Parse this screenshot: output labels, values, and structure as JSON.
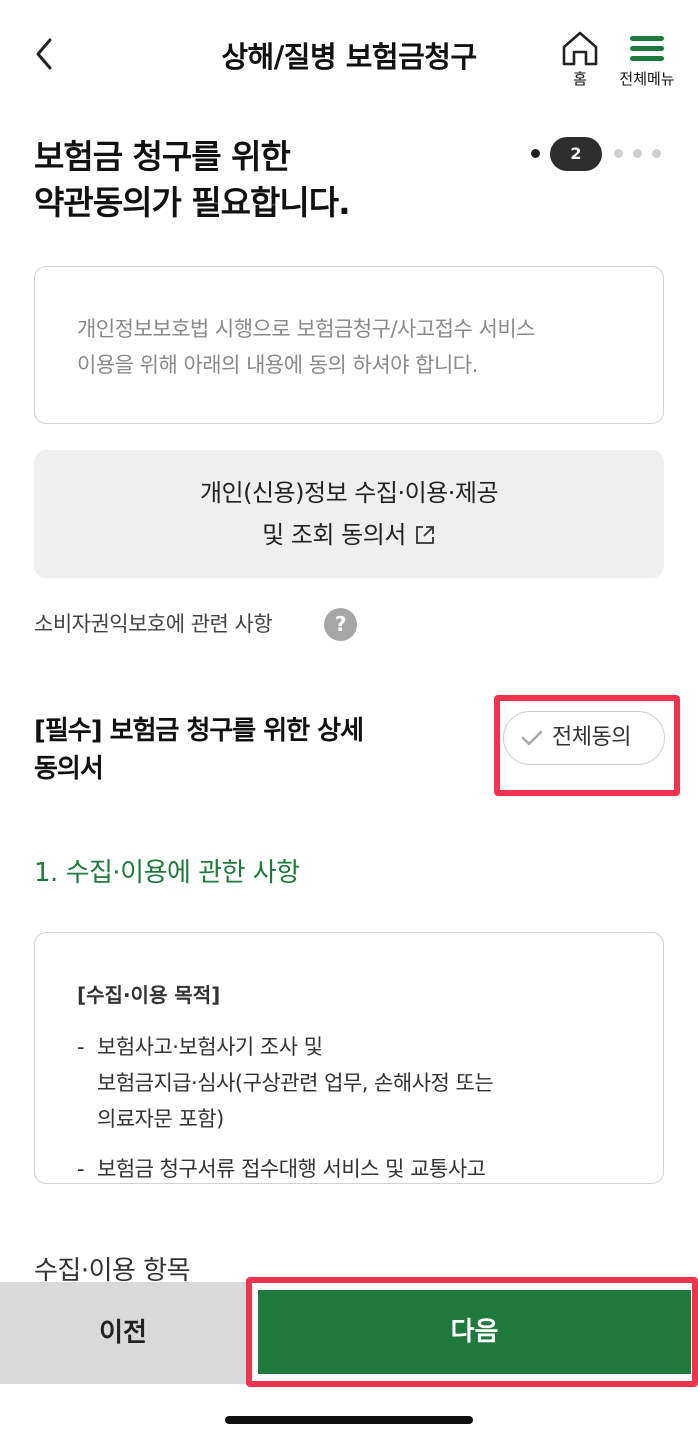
{
  "header": {
    "title": "상해/질병 보험금청구",
    "home_label": "홈",
    "menu_label": "전체메뉴",
    "accent_color": "#1e7a3c"
  },
  "intro": {
    "title_line1": "보험금 청구를 위한",
    "title_line2": "약관동의가 필요합니다."
  },
  "stepper": {
    "current_step": "2"
  },
  "notice": {
    "line1": "개인정보보호법 시행으로 보험금청구/사고접수 서비스",
    "line2": "이용을 위해 아래의 내용에 동의 하셔야 합니다."
  },
  "consent_doc": {
    "line1": "개인(신용)정보 수집·이용·제공",
    "line2": "및 조회 동의서",
    "icon": "external-link-icon"
  },
  "consumer_rights": {
    "label": "소비자권익보호에 관련 사항",
    "icon": "help-icon"
  },
  "required": {
    "title_line1": "[필수] 보험금 청구를 위한 상세",
    "title_line2": "동의서",
    "agree_all_label": "전체동의"
  },
  "section1": {
    "heading": "1. 수집·이용에 관한 사항",
    "purpose_label": "[수집·이용 목적]",
    "items": [
      {
        "dash": "-",
        "line1": "보험사고·보험사기 조사 및",
        "line2": "보험금지급·심사(구상관련 업무, 손해사정 또는",
        "line3": "의료자문 포함)"
      },
      {
        "dash": "-",
        "line1": "보험금 청구서류 접수대행 서비스 및 교통사고"
      }
    ]
  },
  "next_section": {
    "heading": "수집·이용 항목"
  },
  "footer": {
    "prev_label": "이전",
    "next_label": "다음"
  },
  "colors": {
    "highlight": "#f0344f",
    "primary": "#1e7a3c"
  }
}
